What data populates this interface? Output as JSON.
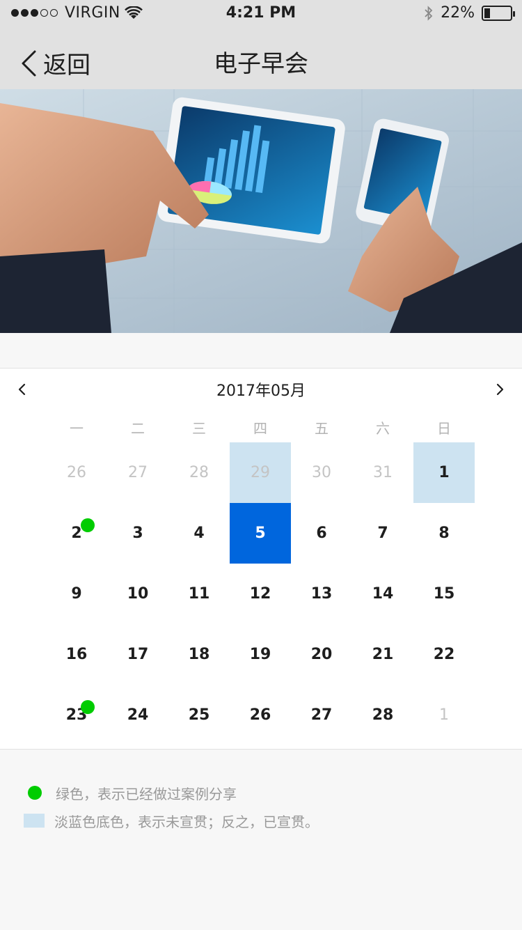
{
  "status_bar": {
    "carrier": "VIRGIN",
    "time": "4:21 PM",
    "battery": "22%",
    "battery_level": 0.22,
    "signal_filled": 3,
    "signal_total": 5
  },
  "navbar": {
    "back_label": "返回",
    "title": "电子早会"
  },
  "banner": {
    "description_icon": "business-tablet-image"
  },
  "calendar": {
    "month_title": "2017年05月",
    "weekdays": [
      "一",
      "二",
      "三",
      "四",
      "五",
      "六",
      "日"
    ],
    "weeks": [
      [
        {
          "d": "26",
          "other": true
        },
        {
          "d": "27",
          "other": true
        },
        {
          "d": "28",
          "other": true
        },
        {
          "d": "29",
          "other": true,
          "unread": true
        },
        {
          "d": "30",
          "other": true
        },
        {
          "d": "31",
          "other": true
        },
        {
          "d": "1",
          "unread": true
        }
      ],
      [
        {
          "d": "2",
          "shared": true
        },
        {
          "d": "3"
        },
        {
          "d": "4"
        },
        {
          "d": "5",
          "selected": true
        },
        {
          "d": "6"
        },
        {
          "d": "7"
        },
        {
          "d": "8"
        }
      ],
      [
        {
          "d": "9"
        },
        {
          "d": "10"
        },
        {
          "d": "11"
        },
        {
          "d": "12"
        },
        {
          "d": "13"
        },
        {
          "d": "14"
        },
        {
          "d": "15"
        }
      ],
      [
        {
          "d": "16"
        },
        {
          "d": "17"
        },
        {
          "d": "18"
        },
        {
          "d": "19"
        },
        {
          "d": "20"
        },
        {
          "d": "21"
        },
        {
          "d": "22"
        }
      ],
      [
        {
          "d": "23",
          "shared": true
        },
        {
          "d": "24"
        },
        {
          "d": "25"
        },
        {
          "d": "26"
        },
        {
          "d": "27"
        },
        {
          "d": "28"
        },
        {
          "d": "1",
          "other": true
        }
      ]
    ]
  },
  "legend": {
    "green_text": "绿色，表示已经做过案例分享",
    "blue_text": "淡蓝色底色，表示未宣贯；反之，已宣贯。"
  },
  "colors": {
    "green": "#00cc00",
    "light_blue": "#cde3f1",
    "selected_blue": "#0066dd",
    "text": "#1e1e1e",
    "muted": "#999999",
    "background": "#f7f7f7",
    "border": "#e1e1e1"
  }
}
